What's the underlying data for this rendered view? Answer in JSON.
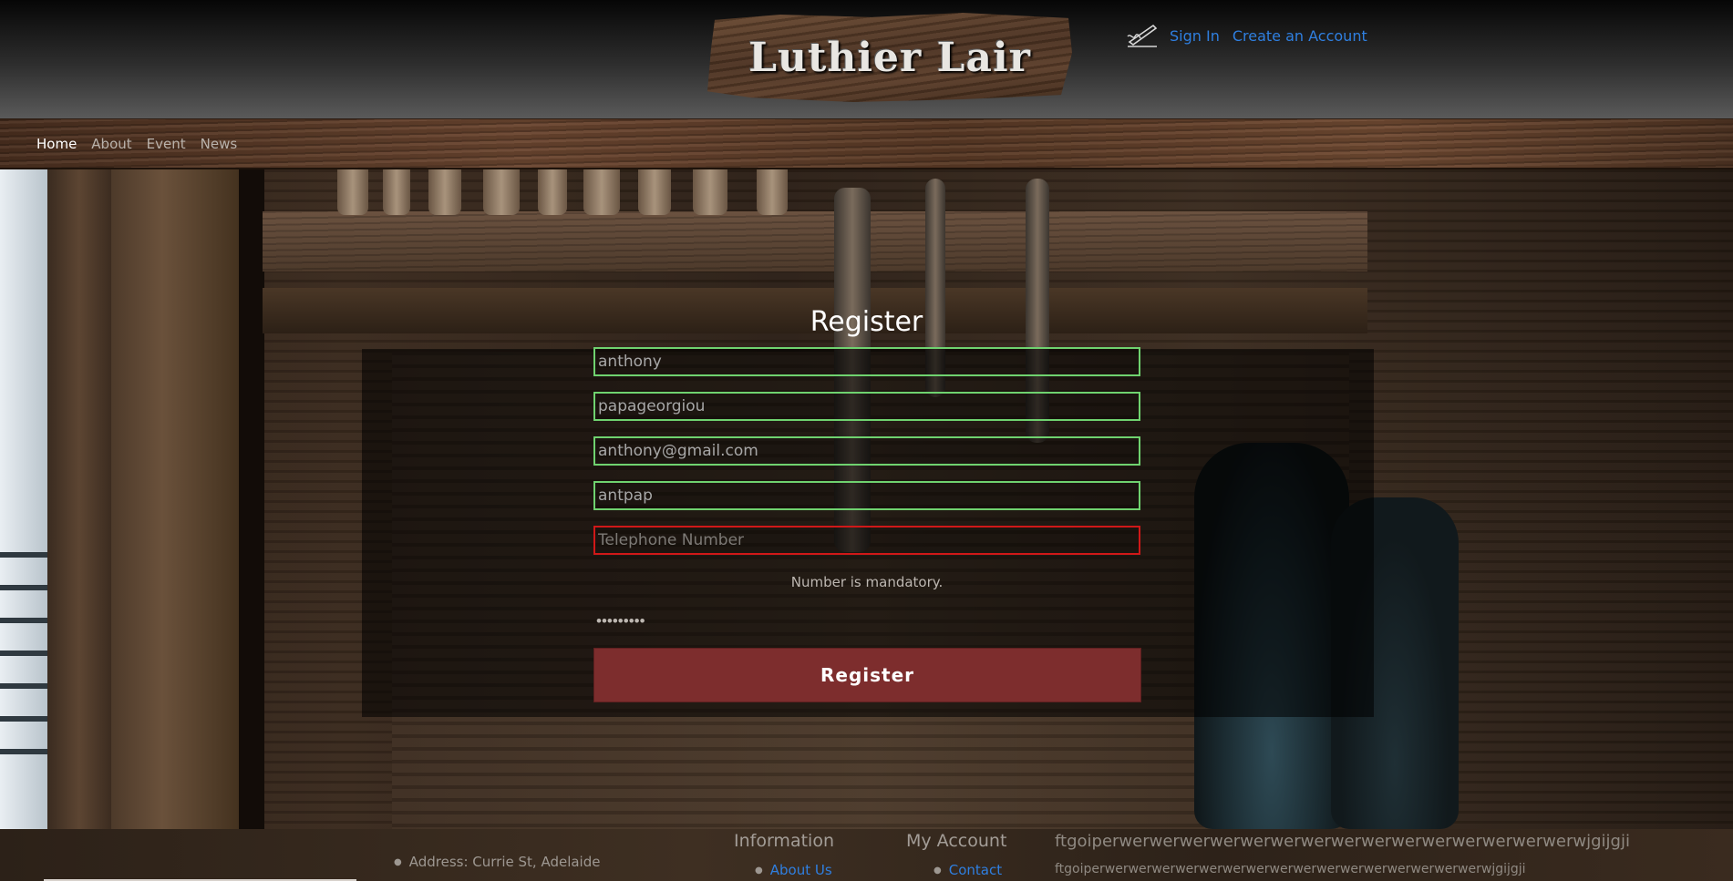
{
  "header": {
    "logo_text": "Luthier Lair",
    "sign_in_label": "Sign In",
    "create_account_label": "Create an Account"
  },
  "nav": {
    "items": [
      {
        "label": "Home"
      },
      {
        "label": "About"
      },
      {
        "label": "Event"
      },
      {
        "label": "News"
      }
    ]
  },
  "register": {
    "title": "Register",
    "first_name_value": "anthony",
    "last_name_value": "papageorgiou",
    "email_value": "anthony@gmail.com",
    "username_value": "antpap",
    "telephone_placeholder": "Telephone Number",
    "telephone_error": "Number is mandatory.",
    "password_value": "•••••••••",
    "button_label": "Register"
  },
  "footer": {
    "address": "Address: Currie St, Adelaide",
    "information_heading": "Information",
    "about_us_label": "About Us",
    "my_account_heading": "My Account",
    "contact_label": "Contact",
    "text_line_1": "ftgoiperwerwerwerwerwerwerwerwerwerwerwerwerwerwerwerwjgijgji",
    "text_line_2": "ftgoiperwerwerwerwerwerwerwerwerwerwerwerwerwerwerwerwerwjgijgji"
  },
  "colors": {
    "link_blue": "#2f7fe0",
    "valid_border": "#6fd26f",
    "error_border": "#d01818",
    "register_button": "#7d2d2d"
  },
  "icons": [
    "signature-pen-icon"
  ]
}
